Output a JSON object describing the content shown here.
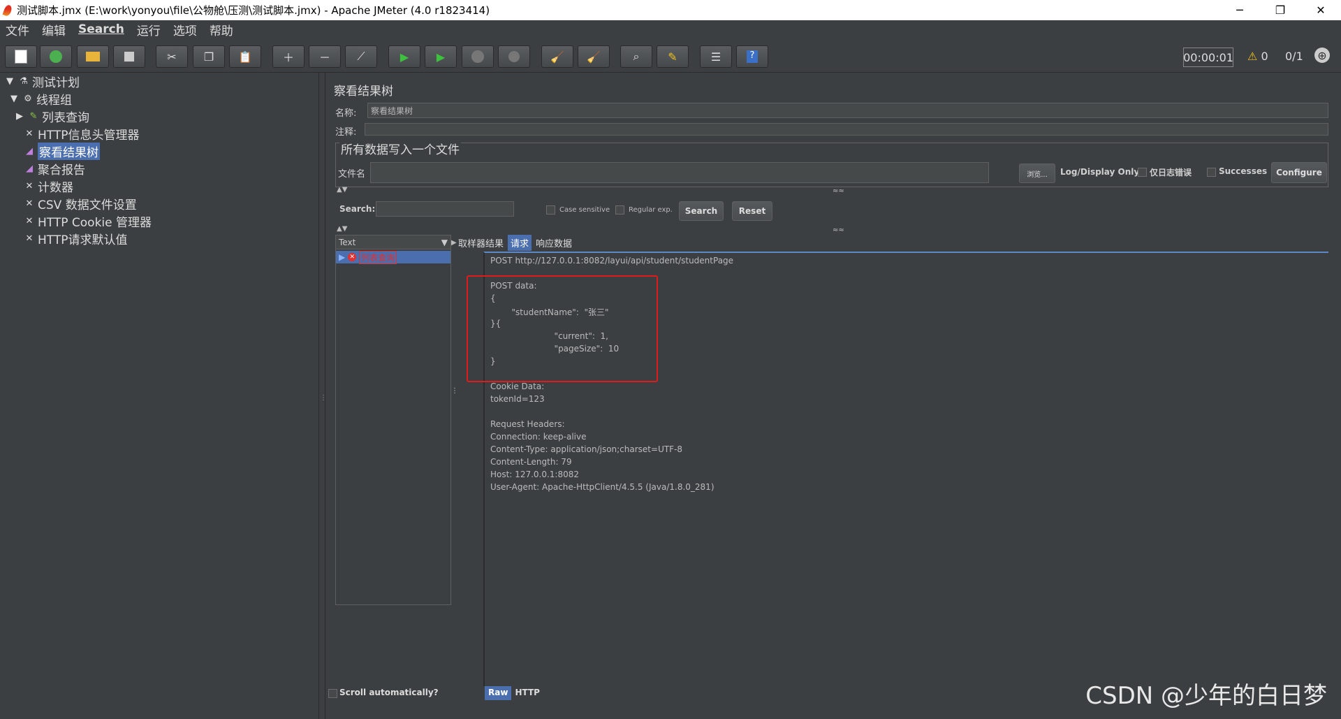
{
  "window": {
    "title": "测试脚本.jmx (E:\\work\\yonyou\\file\\公物舱\\压测\\测试脚本.jmx) - Apache JMeter (4.0 r1823414)",
    "minimize": "─",
    "restore": "❐",
    "close": "✕"
  },
  "menu": [
    "文件",
    "编辑",
    "Search",
    "运行",
    "选项",
    "帮助"
  ],
  "toolbar": {
    "timer": "00:00:01",
    "warnings": "0",
    "threads": "0/1"
  },
  "tree": {
    "items": [
      {
        "label": "测试计划"
      },
      {
        "label": "线程组"
      },
      {
        "label": "列表查询"
      },
      {
        "label": "HTTP信息头管理器"
      },
      {
        "label": "察看结果树"
      },
      {
        "label": "聚合报告"
      },
      {
        "label": "计数器"
      },
      {
        "label": "CSV 数据文件设置"
      },
      {
        "label": "HTTP Cookie 管理器"
      },
      {
        "label": "HTTP请求默认值"
      }
    ]
  },
  "panel": {
    "title": "察看结果树",
    "name_label": "名称:",
    "name_value": "察看结果树",
    "comment_label": "注释:",
    "comment_value": "",
    "file_group_title": "所有数据写入一个文件",
    "filename_label": "文件名",
    "filename_value": "",
    "browse_label": "浏览...",
    "log_display_label": "Log/Display Only:",
    "errors_only_label": "仅日志错误",
    "successes_label": "Successes",
    "configure_label": "Configure",
    "search_label": "Search:",
    "search_value": "",
    "case_sensitive_label": "Case sensitive",
    "regular_exp_label": "Regular exp.",
    "search_button": "Search",
    "reset_button": "Reset",
    "renderer_label": "Text",
    "result_item": "列表查询",
    "scroll_auto_label": "Scroll automatically?",
    "tabs": [
      "取样器结果",
      "请求",
      "响应数据"
    ],
    "bottom_tabs": [
      "Raw",
      "HTTP"
    ]
  },
  "request_lines": [
    "POST http://127.0.0.1:8082/layui/api/student/studentPage",
    "",
    "POST data:",
    "{",
    "        \"studentName\":  \"张三\"",
    "}{",
    "                        \"current\":  1,",
    "                        \"pageSize\":  10",
    "}",
    "",
    "Cookie Data:",
    "tokenId=123",
    "",
    "Request Headers:",
    "Connection: keep-alive",
    "Content-Type: application/json;charset=UTF-8",
    "Content-Length: 79",
    "Host: 127.0.0.1:8082",
    "User-Agent: Apache-HttpClient/4.5.5 (Java/1.8.0_281)"
  ],
  "watermark": "CSDN @少年的白日梦"
}
